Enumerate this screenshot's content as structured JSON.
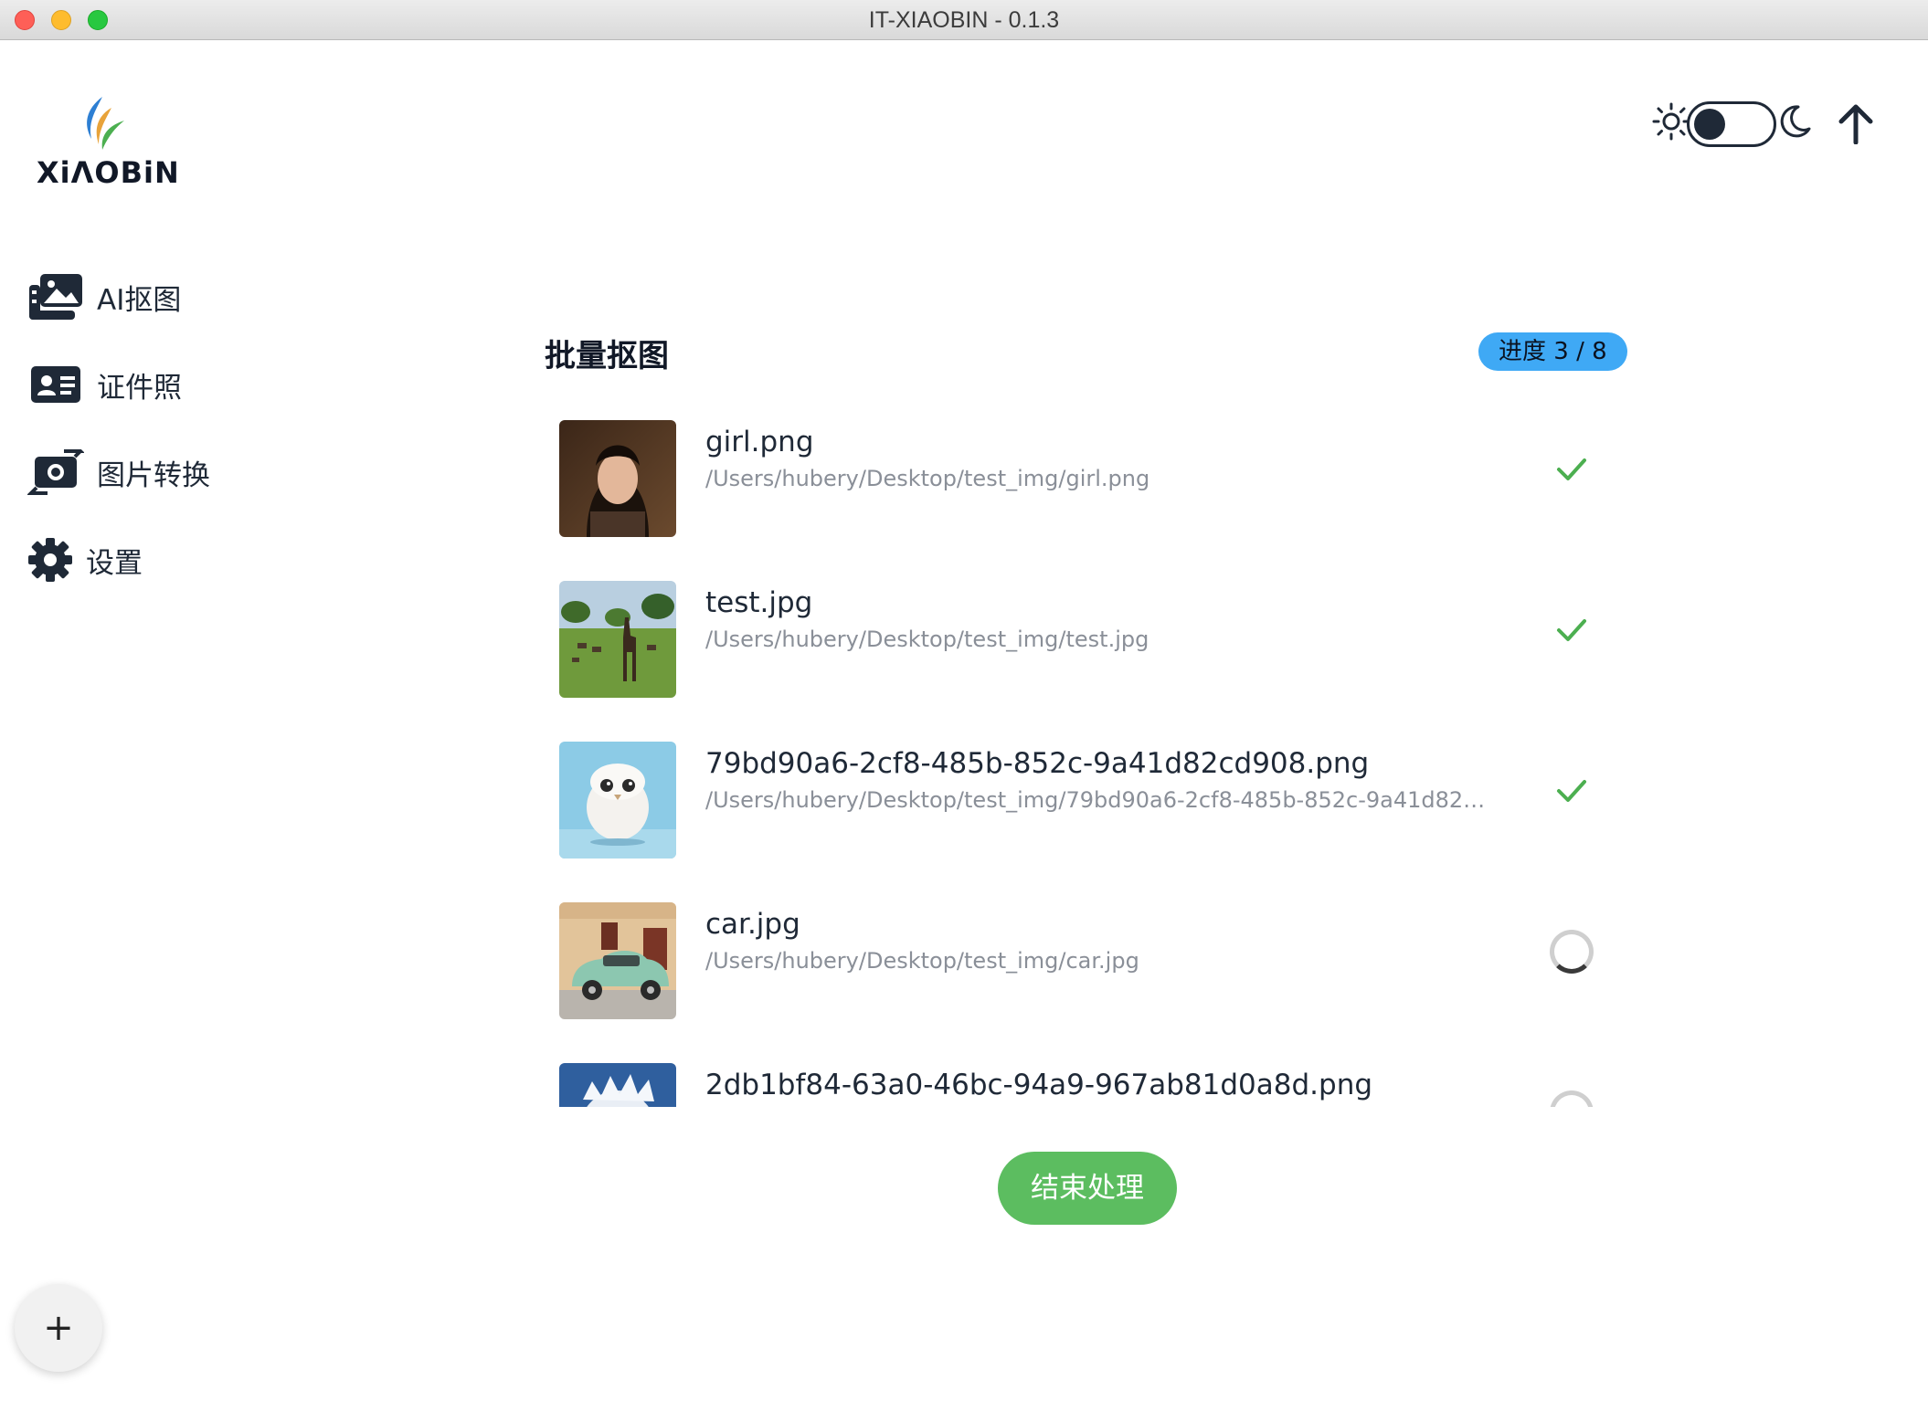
{
  "window": {
    "title": "IT-XIAOBIN - 0.1.3"
  },
  "logo": {
    "text": "XiΛOBiN"
  },
  "sidebar": {
    "items": [
      {
        "label": "AI抠图",
        "icon": "photo-gallery-icon"
      },
      {
        "label": "证件照",
        "icon": "id-card-icon"
      },
      {
        "label": "图片转换",
        "icon": "photo-exchange-icon"
      },
      {
        "label": "设置",
        "icon": "gear-icon"
      }
    ]
  },
  "header": {
    "theme_toggle": {
      "left_icon": "sun-icon",
      "right_icon": "moon-icon",
      "mode": "light"
    },
    "upload_icon": "arrow-up-icon"
  },
  "main": {
    "title": "批量抠图",
    "progress": {
      "label": "进度 3 / 8",
      "done": 3,
      "total": 8
    },
    "files": [
      {
        "name": "girl.png",
        "path": "/Users/hubery/Desktop/test_img/girl.png",
        "status": "done"
      },
      {
        "name": "test.jpg",
        "path": "/Users/hubery/Desktop/test_img/test.jpg",
        "status": "done"
      },
      {
        "name": "79bd90a6-2cf8-485b-852c-9a41d82cd908.png",
        "path": "/Users/hubery/Desktop/test_img/79bd90a6-2cf8-485b-852c-9a41d82cd...",
        "status": "done"
      },
      {
        "name": "car.jpg",
        "path": "/Users/hubery/Desktop/test_img/car.jpg",
        "status": "processing"
      },
      {
        "name": "2db1bf84-63a0-46bc-94a9-967ab81d0a8d.png",
        "path": "",
        "status": "processing"
      }
    ],
    "end_button": "结束处理"
  },
  "fab": {
    "label": "+"
  },
  "colors": {
    "accent_green": "#5cbd60",
    "badge_blue": "#3fa9f5",
    "check_green": "#4caf50"
  }
}
